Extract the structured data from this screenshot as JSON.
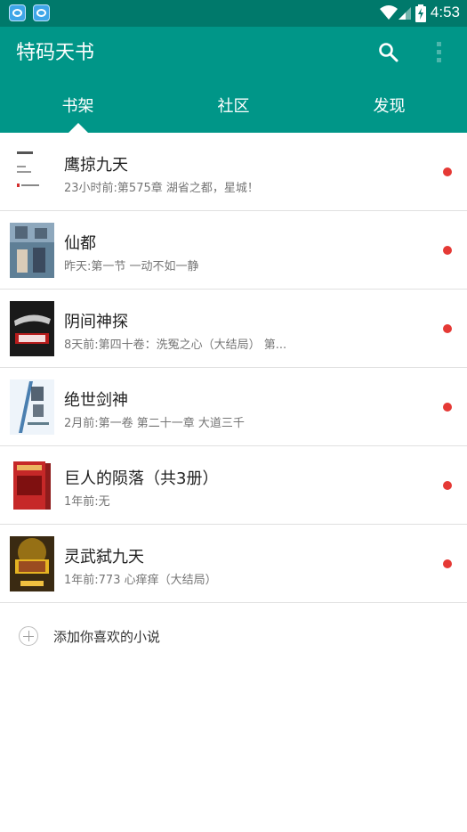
{
  "statusbar": {
    "time": "4:53"
  },
  "appbar": {
    "title": "特码天书",
    "search_icon": "search-icon",
    "more_icon": "more-vert-icon"
  },
  "tabs": [
    {
      "label": "书架",
      "selected": true
    },
    {
      "label": "社区",
      "selected": false
    },
    {
      "label": "发现",
      "selected": false
    }
  ],
  "books": [
    {
      "title": "鹰掠九天",
      "update": "23小时前:第575章 湖省之都，星城！",
      "has_update": true
    },
    {
      "title": "仙都",
      "update": "昨天:第一节 一动不如一静",
      "has_update": true
    },
    {
      "title": "阴间神探",
      "update": "8天前:第四十卷：洗冤之心（大结局） 第...",
      "has_update": true
    },
    {
      "title": "绝世剑神",
      "update": "2月前:第一卷 第二十一章 大道三千",
      "has_update": true
    },
    {
      "title": "巨人的陨落（共3册）",
      "update": "1年前:无",
      "has_update": true
    },
    {
      "title": "灵武弑九天",
      "update": "1年前:773 心痒痒（大结局）",
      "has_update": true
    }
  ],
  "add_book": {
    "label": "添加你喜欢的小说"
  },
  "colors": {
    "primary": "#009688",
    "primary_dark": "#00796b",
    "badge": "#e53935"
  }
}
